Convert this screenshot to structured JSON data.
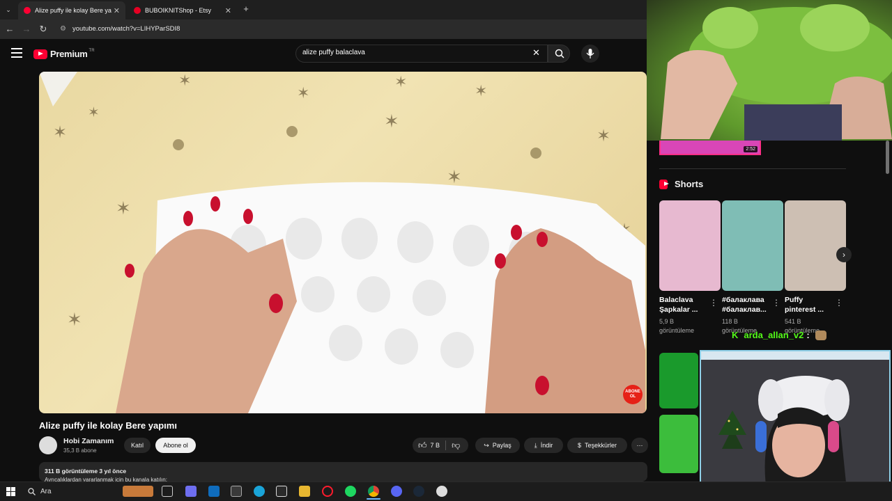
{
  "browser": {
    "tabs": [
      {
        "title": "Alize puffy ile kolay Bere yapımı",
        "active": true,
        "favicon_color": "#ff0033"
      },
      {
        "title": "BUBOIKNITShop - Etsy",
        "active": false,
        "favicon_color": "#e60023"
      }
    ],
    "new_tab": "+",
    "close_glyph": "✕",
    "url": "youtube.com/watch?v=LIHYParSDI8"
  },
  "youtube": {
    "brand": "Premium",
    "region": "TR",
    "search": {
      "value": "alize puffy balaclava"
    },
    "video": {
      "title": "Alize puffy ile kolay Bere yapımı",
      "subscribe_badge_line1": "ABONE",
      "subscribe_badge_line2": "OL"
    },
    "channel": {
      "name": "Hobi Zamanım",
      "subscribers": "35,3 B abone"
    },
    "buttons": {
      "join": "Katıl",
      "subscribe": "Abone ol",
      "likes": "7 B",
      "share": "Paylaş",
      "download": "İndir",
      "thanks": "Teşekkürler"
    },
    "description": {
      "stats": "311 B görüntüleme  3 yıl önce",
      "line": "Ayrıcalıklardan yararlanmak için bu kanala katılın:"
    },
    "sidebar": {
      "top_duration": "2:52",
      "shorts_header": "Shorts",
      "shorts": [
        {
          "title": "Balaclava Şapkalar ...",
          "views": "5,9 B görüntüleme",
          "color": "#e7b9d0"
        },
        {
          "title": "#балаклава #балаклав...",
          "views": "118 B görüntüleme",
          "color": "#7fbdb5"
        },
        {
          "title": "Puffy pinterest ...",
          "views": "541 B görüntüleme",
          "color": "#cdbfb3"
        }
      ]
    }
  },
  "overlays": {
    "streamer_name": "arda_allan_v2",
    "kick_glyph": "K"
  },
  "taskbar": {
    "search_label": "Ara"
  },
  "colors": {
    "accent": "#ff0033",
    "background": "#0f0f0f",
    "kick_green": "#53fc18"
  }
}
